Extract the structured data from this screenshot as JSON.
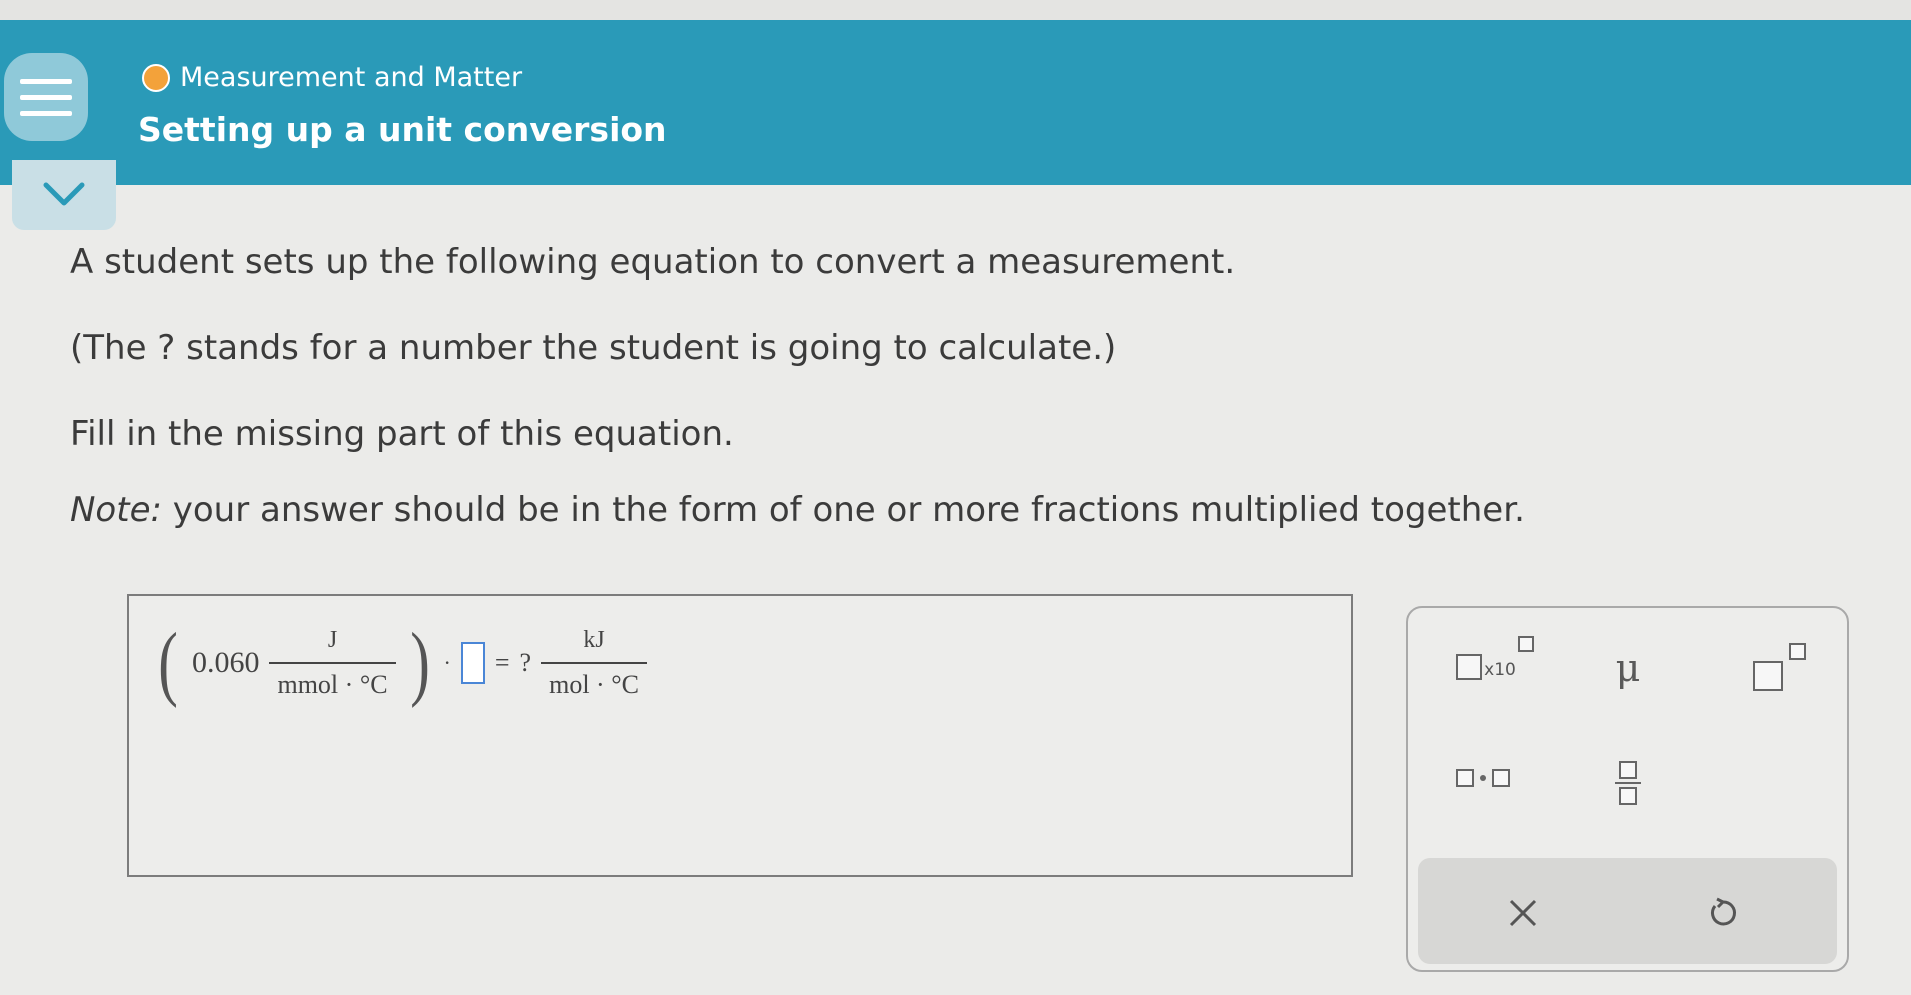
{
  "header": {
    "menu_icon": "hamburger-menu-icon",
    "topic": "Measurement and Matter",
    "title": "Setting up a unit conversion",
    "topic_status_color": "#f3a23a",
    "bar_color": "#2a9ab8"
  },
  "collapse": {
    "icon": "chevron-down-icon"
  },
  "question": {
    "line1": "A student sets up the following equation to convert a measurement.",
    "line2": "(The ? stands for a number the student is going to calculate.)",
    "line3": "Fill in the missing part of this equation.",
    "note_label": "Note:",
    "note_text": " your answer should be in the form of one or more fractions multiplied together."
  },
  "equation": {
    "value": "0.060",
    "numerator_unit": "J",
    "denominator_unit": "mmol · °C",
    "cdot": "·",
    "equals": "=",
    "unknown": "?",
    "result_numerator": "kJ",
    "result_denominator": "mol · °C"
  },
  "palette": {
    "x10_label": "x10",
    "mu_label": "μ",
    "icons": [
      "scientific-notation-icon",
      "mu-symbol",
      "superscript-icon",
      "multiply-dot-icon",
      "fraction-icon",
      "clear-x-icon",
      "undo-icon"
    ]
  }
}
